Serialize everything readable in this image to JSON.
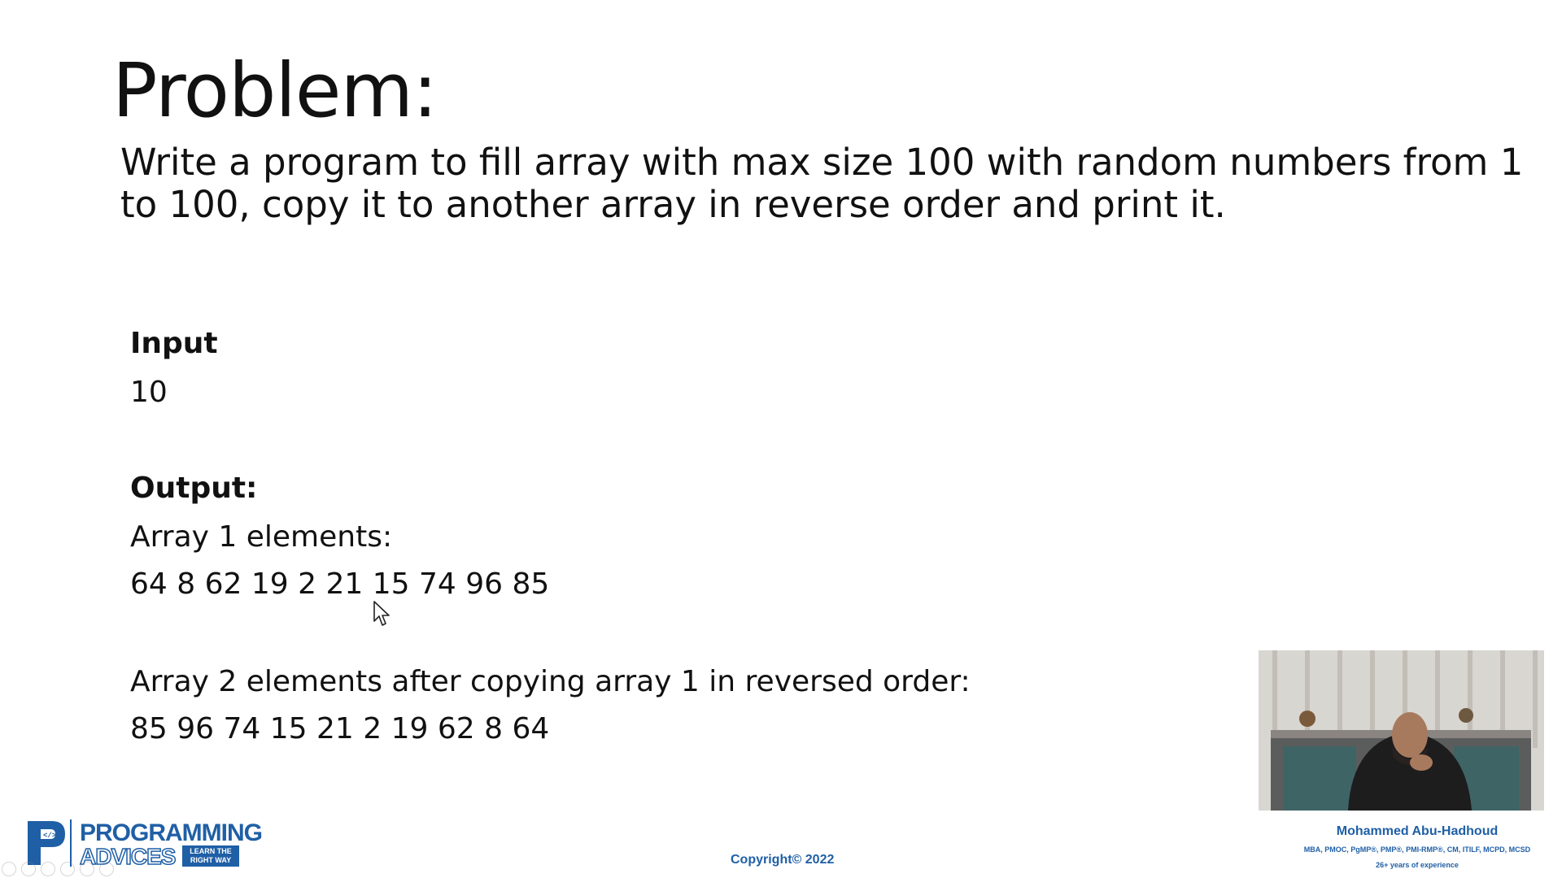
{
  "slide": {
    "title": "Problem:",
    "problem": "Write a program to fill array with max size 100 with random numbers from 1 to 100, copy it to another array in reverse order and print it."
  },
  "example": {
    "input_label": "Input",
    "input_value": "10",
    "output_label": "Output:",
    "array1_label": "Array 1 elements:",
    "array1_values": "64 8 62 19 2 21 15 74 96 85",
    "array2_label": "Array 2 elements after copying array 1 in reversed order:",
    "array2_values": "85 96 74 15 21 2 19 62 8 64"
  },
  "presenter": {
    "name": "Mohammed Abu-Hadhoud",
    "credentials": "MBA, PMOC, PgMP®, PMP®, PMI-RMP®, CM, ITILF, MCPD, MCSD",
    "experience": "26+ years of experience"
  },
  "footer": {
    "copyright": "Copyright© 2022"
  },
  "logo": {
    "line1": "PROGRAMMING",
    "line2": "ADVICES",
    "tagline_1": "LEARN THE",
    "tagline_2": "RIGHT WAY"
  },
  "colors": {
    "brand_blue": "#1f5fa6",
    "text": "#111111",
    "background": "#ffffff"
  }
}
